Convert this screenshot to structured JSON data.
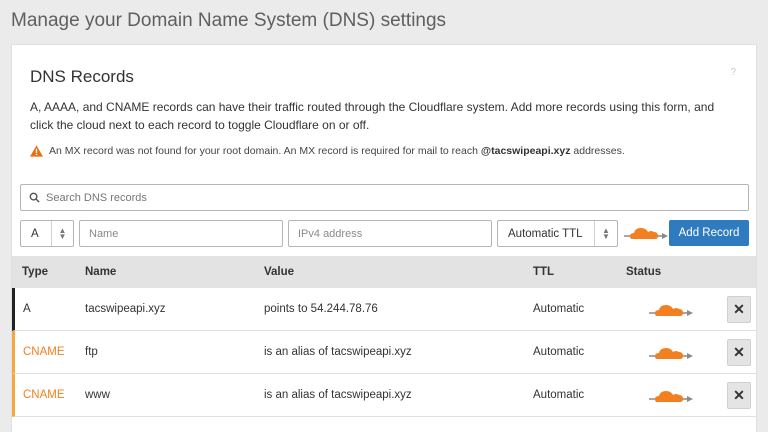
{
  "page": {
    "title": "Manage your Domain Name System (DNS) settings"
  },
  "card": {
    "title": "DNS Records",
    "help_icon": "?",
    "description": "A, AAAA, and CNAME records can have their traffic routed through the Cloudflare system. Add more records using this form, and click the cloud next to each record to toggle Cloudflare on or off.",
    "warning_prefix": "An MX record was not found for your root domain. An MX record is required for mail to reach ",
    "warning_domain": "@tacswipeapi.xyz",
    "warning_suffix": " addresses."
  },
  "search": {
    "placeholder": "Search DNS records",
    "icon": "search-icon"
  },
  "form": {
    "type_value": "A",
    "name_placeholder": "Name",
    "value_placeholder": "IPv4 address",
    "ttl_value": "Automatic TTL",
    "add_label": "Add Record",
    "cloud_icon": "cloud-proxied-icon"
  },
  "table": {
    "headers": {
      "type": "Type",
      "name": "Name",
      "value": "Value",
      "ttl": "TTL",
      "status": "Status"
    },
    "rows": [
      {
        "type": "A",
        "name": "tacswipeapi.xyz",
        "value_prefix": "points to ",
        "value_target": "54.244.78.76",
        "ttl": "Automatic",
        "delete": "✕"
      },
      {
        "type": "CNAME",
        "name": "ftp",
        "value_prefix": "is an alias of ",
        "value_target": "tacswipeapi.xyz",
        "ttl": "Automatic",
        "delete": "✕"
      },
      {
        "type": "CNAME",
        "name": "www",
        "value_prefix": "is an alias of ",
        "value_target": "tacswipeapi.xyz",
        "ttl": "Automatic",
        "delete": "✕"
      }
    ]
  },
  "colors": {
    "accent": "#2f7bbf",
    "cloud": "#f38020",
    "cname": "#f38020"
  }
}
